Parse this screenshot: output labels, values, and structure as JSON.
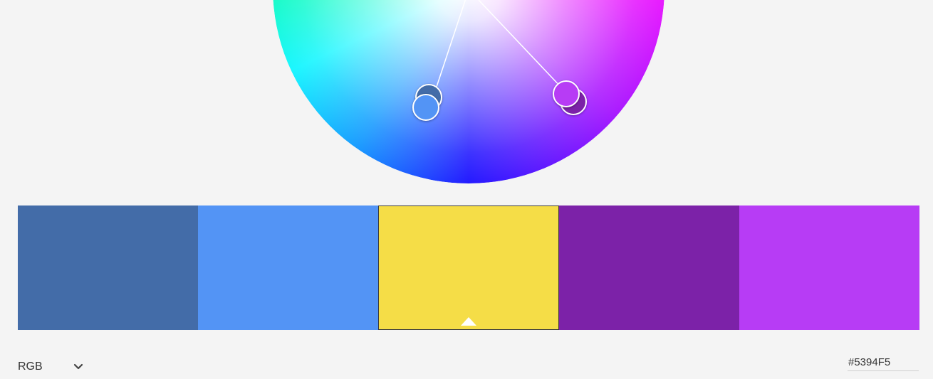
{
  "wheel": {
    "handles": [
      {
        "name": "wheel-handle-1",
        "color": "#436CA8"
      },
      {
        "name": "wheel-handle-2",
        "color": "#5394F5"
      },
      {
        "name": "wheel-handle-3",
        "color": "#F5DD47"
      },
      {
        "name": "wheel-handle-4",
        "color": "#7C22A8"
      },
      {
        "name": "wheel-handle-5",
        "color": "#B73CF5"
      }
    ]
  },
  "swatches": [
    {
      "color": "#436CA8"
    },
    {
      "color": "#5394F5"
    },
    {
      "color": "#F5DD47",
      "selected": true
    },
    {
      "color": "#7C22A8"
    },
    {
      "color": "#B73CF5"
    }
  ],
  "controls": {
    "mode_label": "RGB",
    "mode_icon": "chevron-down-icon",
    "hex_value": "#5394F5"
  }
}
